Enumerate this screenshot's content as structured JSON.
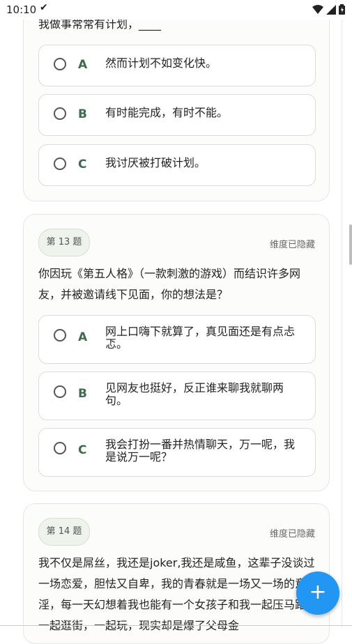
{
  "status_bar": {
    "time": "10:10"
  },
  "question_12": {
    "text": "我做事常常有计划，____",
    "options": [
      {
        "letter": "A",
        "text": "然而计划不如变化快。"
      },
      {
        "letter": "B",
        "text": "有时能完成，有时不能。"
      },
      {
        "letter": "C",
        "text": "我讨厌被打破计划。"
      }
    ]
  },
  "question_13": {
    "number": "第 13 题",
    "dimension_status": "维度已隐藏",
    "text": "你因玩《第五人格》（一款刺激的游戏）而结识许多网友，并被邀请线下见面，你的想法是？",
    "options": [
      {
        "letter": "A",
        "text": "网上口嗨下就算了，真见面还是有点忐忑。"
      },
      {
        "letter": "B",
        "text": "见网友也挺好，反正谁来聊我就聊两句。"
      },
      {
        "letter": "C",
        "text": "我会打扮一番并热情聊天，万一呢，我是说万一呢？"
      }
    ]
  },
  "question_14": {
    "number": "第 14 题",
    "dimension_status": "维度已隐藏",
    "text": "我不仅是屌丝，我还是joker,我还是咸鱼，这辈子没谈过一场恋爱，胆怯又自卑，我的青春就是一场又一场的意淫，每一天幻想着我也能有一个女孩子和我一起压马路，一起逛街，一起玩，现实却是爆了父母金"
  },
  "fab": {
    "label": "+"
  }
}
